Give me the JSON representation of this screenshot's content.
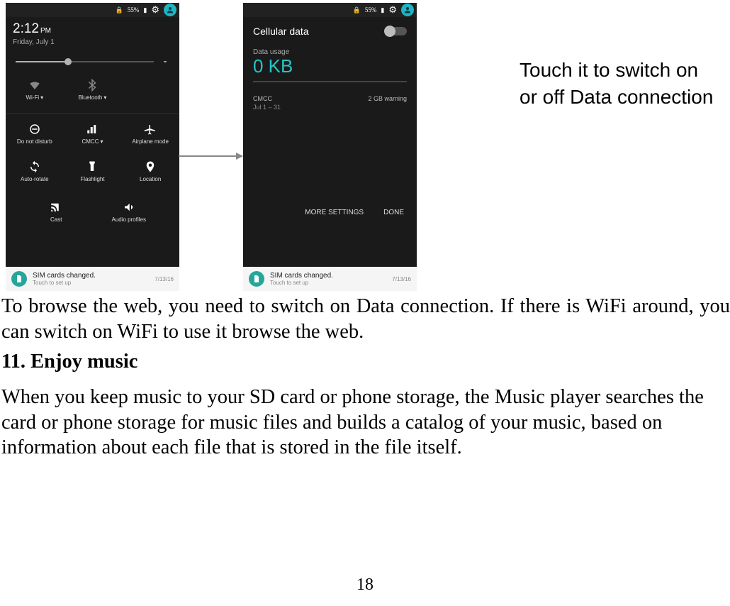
{
  "status": {
    "battery": "55%"
  },
  "phone1": {
    "time": "2:12",
    "ampm": "PM",
    "date": "Friday, July 1",
    "tiles": {
      "wifi": "Wi-Fi",
      "bluetooth": "Bluetooth",
      "dnd": "Do not disturb",
      "cmcc": "CMCC",
      "airplane": "Airplane mode",
      "autorotate": "Auto-rotate",
      "flashlight": "Flashlight",
      "location": "Location",
      "cast": "Cast",
      "audio": "Audio profiles"
    }
  },
  "phone2": {
    "title": "Cellular data",
    "usage_label": "Data usage",
    "usage_value": "0 KB",
    "carrier": "CMCC",
    "warning": "2 GB warning",
    "range": "Jul 1 – 31",
    "more": "MORE SETTINGS",
    "done": "DONE"
  },
  "notif": {
    "title": "SIM cards changed.",
    "sub": "Touch to set up",
    "date": "7/13/16"
  },
  "callout": "Touch it to switch on or off Data connection",
  "body": {
    "p1": "To browse the web, you need to switch on Data connection. If there is WiFi around, you can switch on WiFi to use it browse the web.",
    "heading": "11. Enjoy music",
    "p2": "When you keep music to your SD card or phone storage, the Music player searches the card or phone storage for music files and builds a catalog of your music, based on information about each file that is stored in the file itself."
  },
  "page_number": "18"
}
